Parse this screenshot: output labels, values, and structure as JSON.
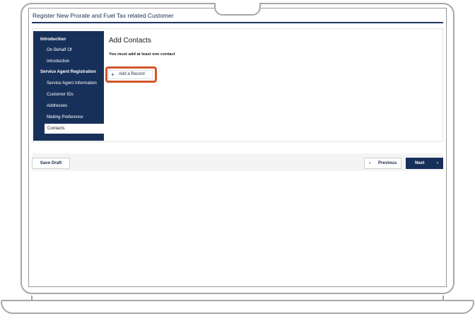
{
  "page": {
    "title": "Register New Prorate and Fuel Tax related Customer"
  },
  "sidebar": {
    "items": [
      {
        "label": "Introduction",
        "kind": "section"
      },
      {
        "label": "On Behalf Of",
        "kind": "sub"
      },
      {
        "label": "Introduction",
        "kind": "sub"
      },
      {
        "label": "Service Agent Registration",
        "kind": "section"
      },
      {
        "label": "Service Agent Information",
        "kind": "sub"
      },
      {
        "label": "Customer IDs",
        "kind": "sub"
      },
      {
        "label": "Addresses",
        "kind": "sub"
      },
      {
        "label": "Mailing Preference",
        "kind": "sub"
      },
      {
        "label": "Contacts",
        "kind": "active"
      }
    ]
  },
  "content": {
    "heading": "Add Contacts",
    "note": "You must add at least one contact",
    "add_record_label": "Add a Record",
    "add_record_icon": "plus-icon",
    "highlight_color": "#d2552b"
  },
  "footer": {
    "save_draft_label": "Save Draft",
    "previous_label": "Previous",
    "previous_icon": "chevron-left-icon",
    "next_label": "Next",
    "next_icon": "chevron-right-icon"
  },
  "colors": {
    "brand_navy": "#17305a",
    "accent_orange": "#d2552b"
  }
}
